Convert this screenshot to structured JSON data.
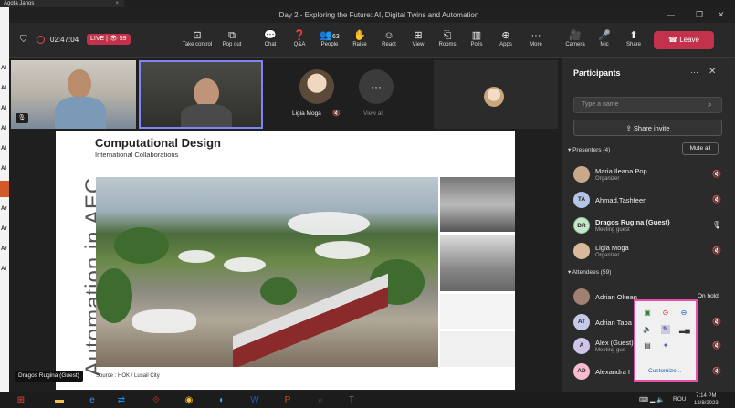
{
  "background_window": {
    "title": "Agota Janos",
    "close": "×"
  },
  "left_strip": [
    "Al",
    "Al",
    "Al",
    "Al",
    "Al",
    "Al",
    "Al",
    "Ar",
    "Ar",
    "Ar",
    "Al"
  ],
  "window": {
    "title": "Day 2 - Exploring the Future: AI, Digital Twins and Automation"
  },
  "toolbar": {
    "timer": "02:47:04",
    "live_label": "LIVE",
    "viewers": "59",
    "items": [
      {
        "icon": "⊡",
        "label": "Take control"
      },
      {
        "icon": "⧉",
        "label": "Pop out"
      },
      {
        "icon": "💬",
        "label": "Chat"
      },
      {
        "icon": "❓",
        "label": "Q&A"
      },
      {
        "icon": "👥",
        "label": "People",
        "count": "63"
      },
      {
        "icon": "✋",
        "label": "Raise"
      },
      {
        "icon": "☺",
        "label": "React"
      },
      {
        "icon": "⊞",
        "label": "View"
      },
      {
        "icon": "⎗",
        "label": "Rooms"
      },
      {
        "icon": "▥",
        "label": "Polls"
      },
      {
        "icon": "⊕",
        "label": "Apps"
      },
      {
        "icon": "···",
        "label": "More"
      },
      {
        "icon": "🎥",
        "label": "Camera"
      },
      {
        "icon": "🎤",
        "label": "Mic"
      },
      {
        "icon": "⬆",
        "label": "Share"
      }
    ],
    "leave_label": "Leave"
  },
  "stage": {
    "ligia_name": "Ligia Moga",
    "view_all": "View all",
    "view_all_icon": "···",
    "presenter_label": "Dragos Rugina (Guest)"
  },
  "slide": {
    "title": "Computational Design",
    "subtitle": "International Collaborations",
    "vertical_text": "Automation in AEC",
    "source": "Source : HOK / Lusail City"
  },
  "participants": {
    "title": "Participants",
    "search_placeholder": "Type a name",
    "share_invite": "Share invite",
    "presenters_header": "Presenters (4)",
    "mute_all": "Mute all",
    "presenters": [
      {
        "name": "Maria Ileana Pop",
        "role": "Organizer",
        "initials": "",
        "color": "#c9a98a"
      },
      {
        "name": "Ahmad.Tashfeen",
        "role": "",
        "initials": "TA",
        "color": "#b4c6e7"
      },
      {
        "name": "Dragos Rugina (Guest)",
        "role": "Meeting guest",
        "initials": "DR",
        "color": "#c8e6c9"
      },
      {
        "name": "Ligia Moga",
        "role": "Organizer",
        "initials": "",
        "color": "#d9b99b"
      }
    ],
    "attendees_header": "Attendees (59)",
    "attendees": [
      {
        "name": "Adrian Oltean",
        "role": "",
        "initials": "",
        "color": "#a08070",
        "status": "On hold"
      },
      {
        "name": "Adrian Taba",
        "role": "",
        "initials": "AT",
        "color": "#c5cae9",
        "status": ""
      },
      {
        "name": "Alex (Guest)",
        "role": "Meeting gue",
        "initials": "A",
        "color": "#d1c4e9",
        "status": ""
      },
      {
        "name": "Alexandra I",
        "role": "",
        "initials": "AD",
        "color": "#f8bbd0",
        "status": ""
      }
    ]
  },
  "tray": {
    "customize": "Customize..."
  },
  "taskbar": {
    "lang": "ROU",
    "time": "7:14 PM",
    "date": "12/8/2023"
  }
}
